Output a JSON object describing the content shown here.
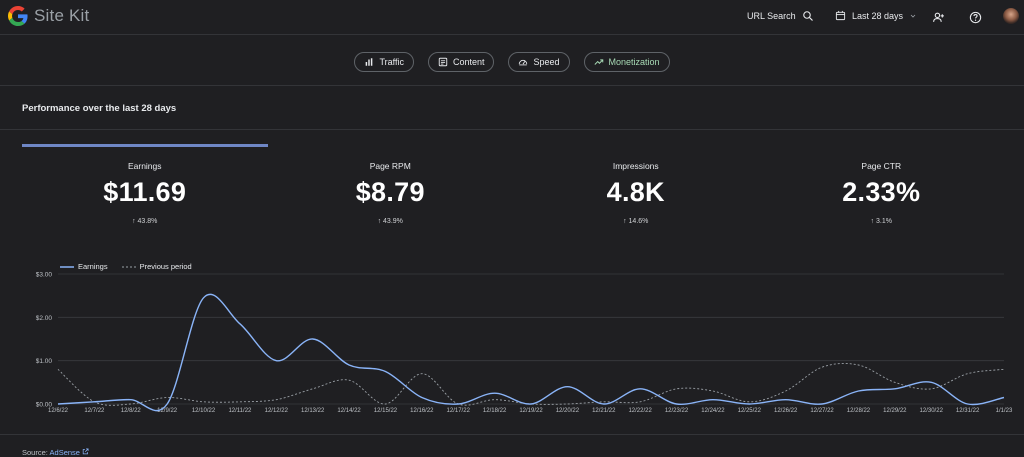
{
  "app": {
    "brand": "Site Kit"
  },
  "header": {
    "url_search": "URL Search",
    "date_range": "Last 28 days"
  },
  "tabs": [
    {
      "label": "Traffic",
      "icon": "bar-chart-icon",
      "active": false
    },
    {
      "label": "Content",
      "icon": "document-icon",
      "active": false
    },
    {
      "label": "Speed",
      "icon": "speedometer-icon",
      "active": false
    },
    {
      "label": "Monetization",
      "icon": "trending-up-icon",
      "active": true
    }
  ],
  "section": {
    "title": "Performance over the last 28 days"
  },
  "metrics": [
    {
      "label": "Earnings",
      "value": "$11.69",
      "change": "↑ 43.8%",
      "selected": true
    },
    {
      "label": "Page RPM",
      "value": "$8.79",
      "change": "↑ 43.9%",
      "selected": false
    },
    {
      "label": "Impressions",
      "value": "4.8K",
      "change": "↑ 14.6%",
      "selected": false
    },
    {
      "label": "Page CTR",
      "value": "2.33%",
      "change": "↑ 3.1%",
      "selected": false
    }
  ],
  "source": {
    "prefix": "Source:",
    "link": "AdSense"
  },
  "colors": {
    "current": "#8ab4f8",
    "previous": "#9aa0a6",
    "accent": "#6f87c6",
    "monetization": "#a8dab5"
  },
  "chart_data": {
    "type": "line",
    "x": [
      "12/6/22",
      "12/7/22",
      "12/8/22",
      "12/9/22",
      "12/10/22",
      "12/11/22",
      "12/12/22",
      "12/13/22",
      "12/14/22",
      "12/15/22",
      "12/16/22",
      "12/17/22",
      "12/18/22",
      "12/19/22",
      "12/20/22",
      "12/21/22",
      "12/22/22",
      "12/23/22",
      "12/24/22",
      "12/25/22",
      "12/26/22",
      "12/27/22",
      "12/28/22",
      "12/29/22",
      "12/30/22",
      "12/31/22",
      "1/1/23"
    ],
    "yticks": [
      "$0.00",
      "$1.00",
      "$2.00",
      "$3.00"
    ],
    "ylim": [
      0,
      3
    ],
    "grid": true,
    "legend_position": "top-left",
    "series": [
      {
        "name": "Earnings",
        "style": "solid",
        "values": [
          0.0,
          0.05,
          0.1,
          0.0,
          2.45,
          1.85,
          1.0,
          1.5,
          0.9,
          0.75,
          0.15,
          0.0,
          0.25,
          0.0,
          0.4,
          0.0,
          0.35,
          0.0,
          0.1,
          0.0,
          0.1,
          0.0,
          0.3,
          0.35,
          0.5,
          0.0,
          0.15
        ]
      },
      {
        "name": "Previous period",
        "style": "dashed",
        "values": [
          0.8,
          0.05,
          0.0,
          0.15,
          0.05,
          0.05,
          0.1,
          0.35,
          0.55,
          0.0,
          0.7,
          0.0,
          0.1,
          0.0,
          0.0,
          0.05,
          0.05,
          0.35,
          0.3,
          0.05,
          0.3,
          0.85,
          0.9,
          0.5,
          0.35,
          0.7,
          0.8
        ]
      }
    ]
  }
}
